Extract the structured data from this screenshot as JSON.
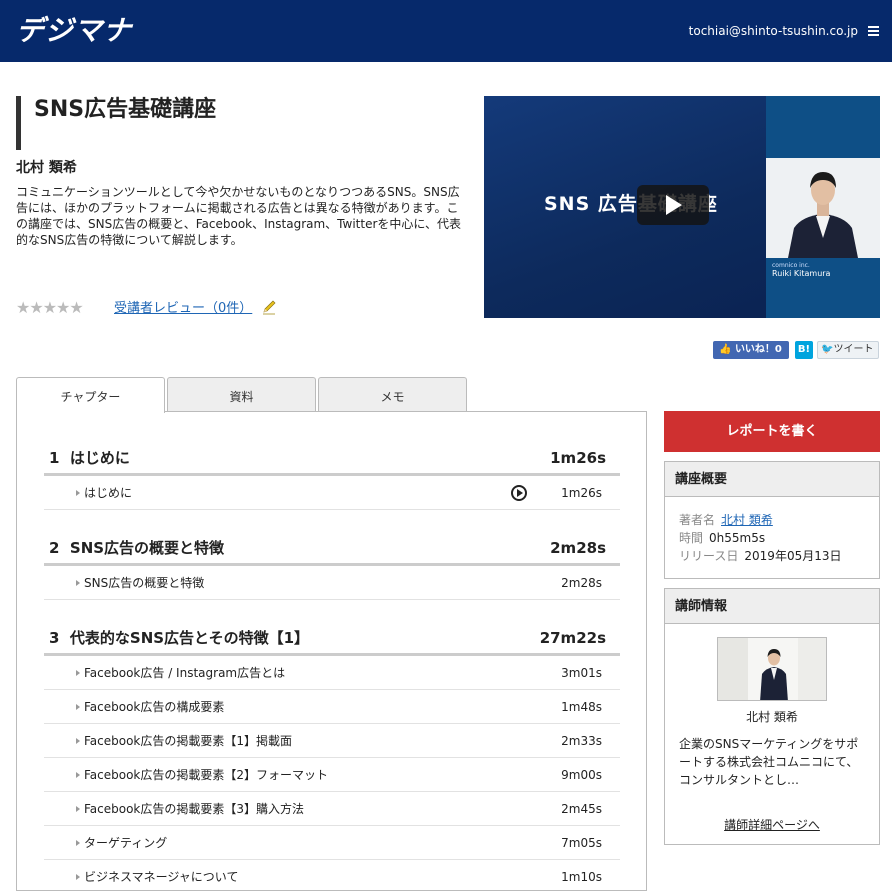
{
  "header": {
    "logo": "デジマナ",
    "user_email": "tochiai@shinto-tsushin.co.jp"
  },
  "course": {
    "title": "SNS広告基礎講座",
    "instructor": "北村 類希",
    "description": "コミュニケーションツールとして今や欠かせないものとなりつつあるSNS。SNS広告には、ほかのプラットフォームに掲載される広告とは異なる特徴があります。この講座では、SNS広告の概要と、Facebook、Instagram、Twitterを中心に、代表的なSNS広告の特徴について解説します。",
    "stars": "★★★★★",
    "rating_stars": 0,
    "review_link": "受講者レビュー（0件）"
  },
  "video": {
    "title": "SNS 広告基礎講座",
    "caption_company": "comnico inc.",
    "caption_name": "Ruiki Kitamura"
  },
  "social": {
    "like": "いいね！0",
    "hatena": "B!",
    "tweet": "ツイート"
  },
  "tabs": [
    {
      "label": "チャプター"
    },
    {
      "label": "資料"
    },
    {
      "label": "メモ"
    }
  ],
  "chapters": [
    {
      "number": "1",
      "title": "はじめに",
      "time": "1m26s",
      "lessons": [
        {
          "label": "はじめに",
          "time": "1m26s"
        }
      ]
    },
    {
      "number": "2",
      "title": "SNS広告の概要と特徴",
      "time": "2m28s",
      "lessons": [
        {
          "label": "SNS広告の概要と特徴",
          "time": "2m28s"
        }
      ]
    },
    {
      "number": "3",
      "title": "代表的なSNS広告とその特徴【1】",
      "time": "27m22s",
      "lessons": [
        {
          "label": "Facebook広告 / Instagram広告とは",
          "time": "3m01s"
        },
        {
          "label": "Facebook広告の構成要素",
          "time": "1m48s"
        },
        {
          "label": "Facebook広告の掲載要素【1】掲載面",
          "time": "2m33s"
        },
        {
          "label": "Facebook広告の掲載要素【2】フォーマット",
          "time": "9m00s"
        },
        {
          "label": "Facebook広告の掲載要素【3】購入方法",
          "time": "2m45s"
        },
        {
          "label": "ターゲティング",
          "time": "7m05s"
        },
        {
          "label": "ビジネスマネージャについて",
          "time": "1m10s"
        }
      ]
    }
  ],
  "sidebar": {
    "report_button": "レポートを書く",
    "overview": {
      "heading": "講座概要",
      "author_label": "著者名",
      "author_value": "北村 類希",
      "duration_label": "時間",
      "duration_value": "0h55m5s",
      "release_label": "リリース日",
      "release_value": "2019年05月13日"
    },
    "teacher": {
      "heading": "講師情報",
      "name": "北村 類希",
      "description": "企業のSNSマーケティングをサポートする株式会社コムニコにて、コンサルタントとし…",
      "detail_link": "講師詳細ページへ"
    }
  },
  "colors": {
    "header_bg": "#06296b",
    "report_button": "#cf3030",
    "link": "#1f66b5"
  }
}
